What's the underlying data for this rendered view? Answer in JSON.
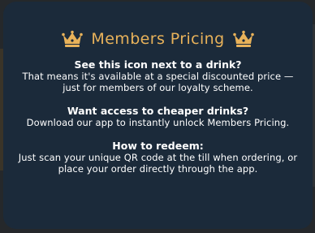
{
  "card": {
    "title": "Members Pricing",
    "title_color": "#e8b25a",
    "background_color": "#1b2a3a",
    "icons": [
      "crown-icon",
      "crown-icon"
    ],
    "sections": [
      {
        "heading": "See this icon next to a drink?",
        "body": "That means it's available at a special discounted price — just for members of our loyalty scheme."
      },
      {
        "heading": "Want access to cheaper drinks?",
        "body": "Download our app to instantly unlock Members Pricing."
      },
      {
        "heading": "How to redeem:",
        "body": "Just scan your unique QR code at the till when ordering, or place your order directly through the app."
      }
    ]
  }
}
